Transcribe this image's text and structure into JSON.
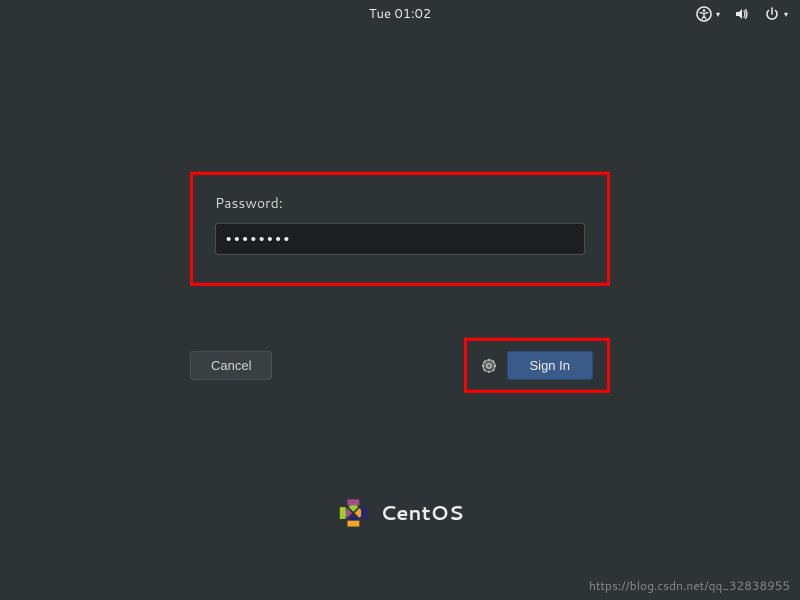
{
  "topbar": {
    "clock": "Tue 01:02"
  },
  "login": {
    "password_label": "Password:",
    "password_value": "●●●●●●●●",
    "cancel_label": "Cancel",
    "signin_label": "Sign In"
  },
  "branding": {
    "name": "CentOS"
  },
  "watermark": {
    "text": "https://blog.csdn.net/qq_32838955"
  }
}
